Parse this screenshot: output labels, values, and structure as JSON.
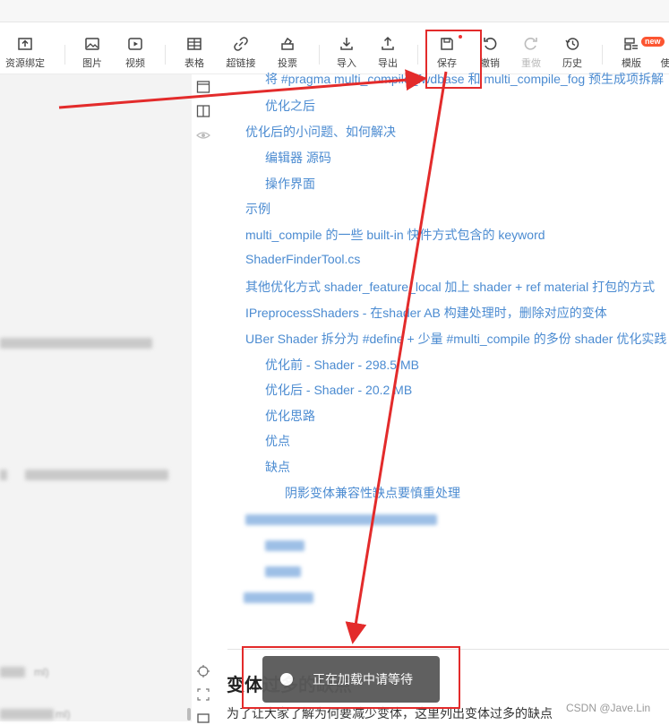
{
  "toolbar": {
    "items": [
      {
        "label": "资源绑定",
        "icon": "upload-box-icon"
      },
      {
        "label": "图片",
        "icon": "image-icon"
      },
      {
        "label": "视频",
        "icon": "video-icon"
      },
      {
        "label": "表格",
        "icon": "table-icon"
      },
      {
        "label": "超链接",
        "icon": "link-icon"
      },
      {
        "label": "投票",
        "icon": "vote-icon"
      },
      {
        "label": "导入",
        "icon": "import-icon"
      },
      {
        "label": "导出",
        "icon": "export-icon"
      },
      {
        "label": "保存",
        "icon": "save-icon"
      },
      {
        "label": "撤销",
        "icon": "undo-icon"
      },
      {
        "label": "重做",
        "icon": "redo-icon"
      },
      {
        "label": "历史",
        "icon": "history-icon"
      },
      {
        "label": "模版",
        "icon": "template-icon"
      },
      {
        "label": "使",
        "icon": ""
      }
    ],
    "new_badge": "new"
  },
  "toc": {
    "items": [
      {
        "text": "将 #pragma multi_compile_fwdbase 和 multi_compile_fog 预生成项拆解"
      },
      {
        "text": "优化之后"
      },
      {
        "text": "优化后的小问题、如何解决"
      },
      {
        "text": "编辑器 源码"
      },
      {
        "text": "操作界面"
      },
      {
        "text": "示例"
      },
      {
        "text": "multi_compile 的一些 built-in 快件方式包含的 keyword"
      },
      {
        "text": "ShaderFinderTool.cs"
      },
      {
        "text": "其他优化方式 shader_feature_local 加上 shader + ref material 打包的方式"
      },
      {
        "text": "IPreprocessShaders - 在shader AB 构建处理时，删除对应的变体"
      },
      {
        "text": "UBer Shader 拆分为 #define + 少量 #multi_compile 的多份 shader 优化实践"
      },
      {
        "text": "优化前 - Shader - 298.5 MB"
      },
      {
        "text": "优化后 - Shader - 20.2 MB"
      },
      {
        "text": "优化思路"
      },
      {
        "text": "优点"
      },
      {
        "text": "缺点"
      },
      {
        "text": "阴影变体兼容性缺点要慎重处理"
      }
    ]
  },
  "left_panel": {
    "blurred_lines": [
      "ml)",
      "ml)"
    ]
  },
  "article": {
    "heading": "变体过多的缺点",
    "paragraph": "为了让大家了解为何要减少变体，这里列出变体过多的缺点"
  },
  "toast": {
    "text": "正在加载中请等待"
  },
  "watermark": "CSDN @Jave.Lin",
  "colors": {
    "link": "#4b8bd1",
    "annotation_red": "#e32b2b",
    "toast_bg": "#5a5a5a"
  }
}
